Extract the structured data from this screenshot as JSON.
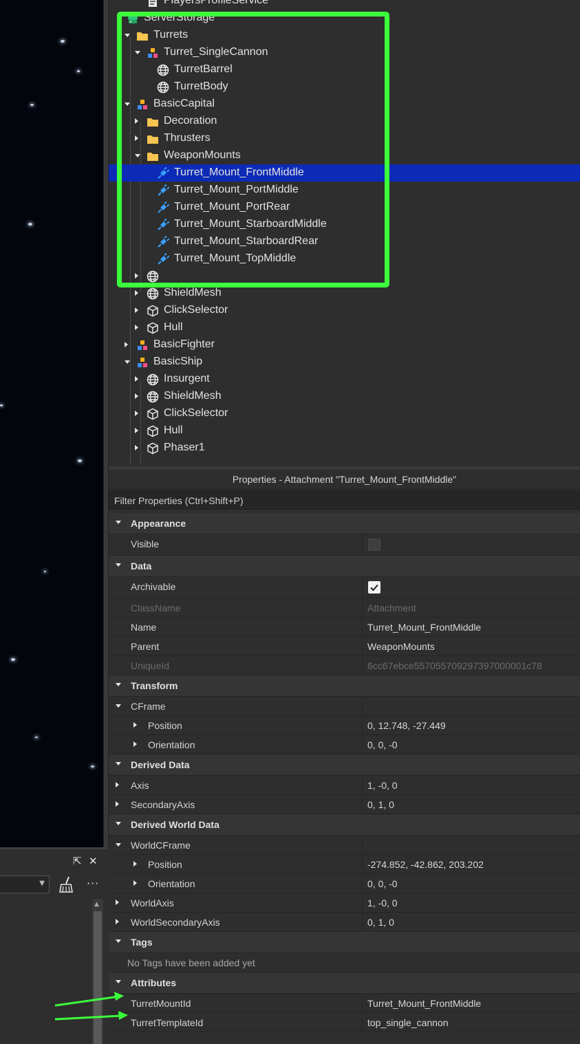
{
  "explorer": {
    "rows": [
      {
        "label": "PlayersProfileService",
        "icon": "script-icon",
        "indent": 2,
        "arrow": "none"
      },
      {
        "label": "ServerStorage",
        "icon": "server-storage-icon",
        "indent": 0,
        "arrow": "none"
      },
      {
        "label": "Turrets",
        "icon": "folder-icon",
        "indent": 1,
        "arrow": "down"
      },
      {
        "label": "Turret_SingleCannon",
        "icon": "model-icon",
        "indent": 2,
        "arrow": "down"
      },
      {
        "label": "TurretBarrel",
        "icon": "meshpart-icon",
        "indent": 3,
        "arrow": "none"
      },
      {
        "label": "TurretBody",
        "icon": "meshpart-icon",
        "indent": 3,
        "arrow": "none"
      },
      {
        "label": "BasicCapital",
        "icon": "model-icon",
        "indent": 1,
        "arrow": "down"
      },
      {
        "label": "Decoration",
        "icon": "folder-icon",
        "indent": 2,
        "arrow": "right"
      },
      {
        "label": "Thrusters",
        "icon": "folder-icon",
        "indent": 2,
        "arrow": "right"
      },
      {
        "label": "WeaponMounts",
        "icon": "folder-icon",
        "indent": 2,
        "arrow": "down"
      },
      {
        "label": "Turret_Mount_FrontMiddle",
        "icon": "attachment-icon",
        "indent": 3,
        "arrow": "none",
        "selected": true
      },
      {
        "label": "Turret_Mount_PortMiddle",
        "icon": "attachment-icon",
        "indent": 3,
        "arrow": "none"
      },
      {
        "label": "Turret_Mount_PortRear",
        "icon": "attachment-icon",
        "indent": 3,
        "arrow": "none"
      },
      {
        "label": "Turret_Mount_StarboardMiddle",
        "icon": "attachment-icon",
        "indent": 3,
        "arrow": "none"
      },
      {
        "label": "Turret_Mount_StarboardRear",
        "icon": "attachment-icon",
        "indent": 3,
        "arrow": "none"
      },
      {
        "label": "Turret_Mount_TopMiddle",
        "icon": "attachment-icon",
        "indent": 3,
        "arrow": "none"
      },
      {
        "label": "",
        "icon": "meshpart-icon",
        "indent": 2,
        "arrow": "right"
      },
      {
        "label": "ShieldMesh",
        "icon": "meshpart-icon",
        "indent": 2,
        "arrow": "right"
      },
      {
        "label": "ClickSelector",
        "icon": "part-icon",
        "indent": 2,
        "arrow": "right"
      },
      {
        "label": "Hull",
        "icon": "part-icon",
        "indent": 2,
        "arrow": "right"
      },
      {
        "label": "BasicFighter",
        "icon": "model-icon",
        "indent": 1,
        "arrow": "right"
      },
      {
        "label": "BasicShip",
        "icon": "model-icon",
        "indent": 1,
        "arrow": "down"
      },
      {
        "label": "Insurgent",
        "icon": "meshpart-icon",
        "indent": 2,
        "arrow": "right"
      },
      {
        "label": "ShieldMesh",
        "icon": "meshpart-icon",
        "indent": 2,
        "arrow": "right"
      },
      {
        "label": "ClickSelector",
        "icon": "part-icon",
        "indent": 2,
        "arrow": "right"
      },
      {
        "label": "Hull",
        "icon": "part-icon",
        "indent": 2,
        "arrow": "right"
      },
      {
        "label": "Phaser1",
        "icon": "part-icon",
        "indent": 2,
        "arrow": "right"
      }
    ]
  },
  "properties": {
    "title": "Properties - Attachment \"Turret_Mount_FrontMiddle\"",
    "filter_placeholder": "Filter Properties (Ctrl+Shift+P)",
    "rows": [
      {
        "type": "section",
        "name": "Appearance"
      },
      {
        "type": "checkbox",
        "name": "Visible",
        "checked": false
      },
      {
        "type": "section",
        "name": "Data"
      },
      {
        "type": "checkbox",
        "name": "Archivable",
        "checked": true
      },
      {
        "type": "prop",
        "name": "ClassName",
        "value": "Attachment",
        "dim": true
      },
      {
        "type": "prop",
        "name": "Name",
        "value": "Turret_Mount_FrontMiddle"
      },
      {
        "type": "prop",
        "name": "Parent",
        "value": "WeaponMounts"
      },
      {
        "type": "prop",
        "name": "UniqueId",
        "value": "6cc67ebce557055709297397000001c78",
        "dim": true
      },
      {
        "type": "section",
        "name": "Transform"
      },
      {
        "type": "group",
        "name": "CFrame",
        "value": ""
      },
      {
        "type": "sub",
        "name": "Position",
        "value": "0, 12.748, -27.449"
      },
      {
        "type": "sub",
        "name": "Orientation",
        "value": "0, 0, -0"
      },
      {
        "type": "section",
        "name": "Derived Data"
      },
      {
        "type": "expand",
        "name": "Axis",
        "value": "1, -0, 0"
      },
      {
        "type": "expand",
        "name": "SecondaryAxis",
        "value": "0, 1, 0"
      },
      {
        "type": "section",
        "name": "Derived World Data"
      },
      {
        "type": "group",
        "name": "WorldCFrame",
        "value": ""
      },
      {
        "type": "sub",
        "name": "Position",
        "value": "-274.852, -42.862, 203.202"
      },
      {
        "type": "sub",
        "name": "Orientation",
        "value": "0, 0, -0"
      },
      {
        "type": "expand",
        "name": "WorldAxis",
        "value": "1, -0, 0"
      },
      {
        "type": "expand",
        "name": "WorldSecondaryAxis",
        "value": "0, 1, 0"
      },
      {
        "type": "section",
        "name": "Tags"
      },
      {
        "type": "note",
        "name": "No Tags have been added yet"
      },
      {
        "type": "section",
        "name": "Attributes"
      },
      {
        "type": "plain",
        "name": "TurretMountId",
        "value": "Turret_Mount_FrontMiddle"
      },
      {
        "type": "plain",
        "name": "TurretTemplateId",
        "value": "top_single_cannon"
      }
    ]
  },
  "annotations": {
    "highlight_color": "#3cff3c",
    "arrow_color": "#3cff3c"
  },
  "colors": {
    "selection": "#0c2bb6",
    "panel_bg": "#2e2e2e",
    "folder": "#f5c451",
    "attachment": "#3aa0ff"
  }
}
